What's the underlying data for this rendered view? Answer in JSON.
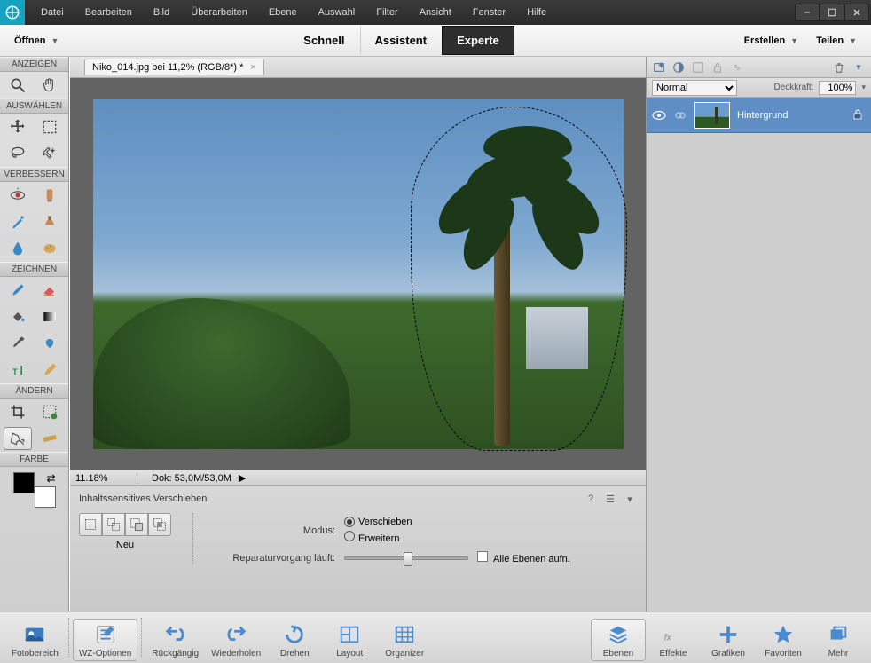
{
  "menu": {
    "file": "Datei",
    "edit": "Bearbeiten",
    "image": "Bild",
    "enhance": "Überarbeiten",
    "layer": "Ebene",
    "select": "Auswahl",
    "filter": "Filter",
    "view": "Ansicht",
    "window": "Fenster",
    "help": "Hilfe"
  },
  "modebar": {
    "open": "Öffnen",
    "quick": "Schnell",
    "guided": "Assistent",
    "expert": "Experte",
    "create": "Erstellen",
    "share": "Teilen"
  },
  "toolbox": {
    "view": "ANZEIGEN",
    "select": "AUSWÄHLEN",
    "enhance": "VERBESSERN",
    "draw": "ZEICHNEN",
    "modify": "ÄNDERN",
    "color": "FARBE"
  },
  "document": {
    "tab": "Niko_014.jpg bei 11,2% (RGB/8*) *",
    "zoom": "11.18%",
    "docinfo": "Dok: 53,0M/53,0M"
  },
  "options": {
    "title": "Inhaltssensitives Verschieben",
    "new": "Neu",
    "mode_label": "Modus:",
    "mode_move": "Verschieben",
    "mode_extend": "Erweitern",
    "repair_label": "Reparaturvorgang läuft:",
    "all_layers": "Alle Ebenen aufn."
  },
  "layers": {
    "blend": "Normal",
    "opacity_label": "Deckkraft:",
    "opacity": "100%",
    "bg_name": "Hintergrund"
  },
  "bottom": {
    "photo_bin": "Fotobereich",
    "tool_opts": "WZ-Optionen",
    "undo": "Rückgängig",
    "redo": "Wiederholen",
    "rotate": "Drehen",
    "layout": "Layout",
    "organizer": "Organizer",
    "layers": "Ebenen",
    "effects": "Effekte",
    "graphics": "Grafiken",
    "favorites": "Favoriten",
    "more": "Mehr"
  }
}
